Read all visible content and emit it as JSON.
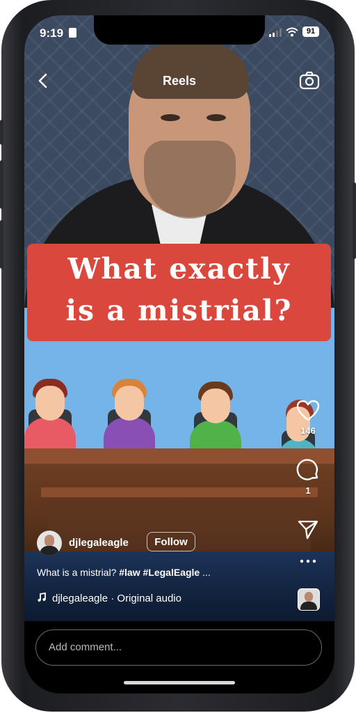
{
  "status_bar": {
    "time": "9:19",
    "battery": "91"
  },
  "header": {
    "title": "Reels"
  },
  "video": {
    "banner_line1": "What exactly",
    "banner_line2": "is a mistrial?"
  },
  "actions": {
    "likes": "146",
    "comments": "1"
  },
  "author": {
    "username": "djlegaleagle",
    "follow_label": "Follow"
  },
  "caption": {
    "text": "What is a mistrial?",
    "tags": "#law #LegalEagle",
    "more": "..."
  },
  "audio": {
    "label": "djlegaleagle · Original audio"
  },
  "comment": {
    "placeholder": "Add comment..."
  },
  "colors": {
    "banner": "#d9473d",
    "background_blue": "#74b4e9",
    "desk": "#8e5030"
  }
}
